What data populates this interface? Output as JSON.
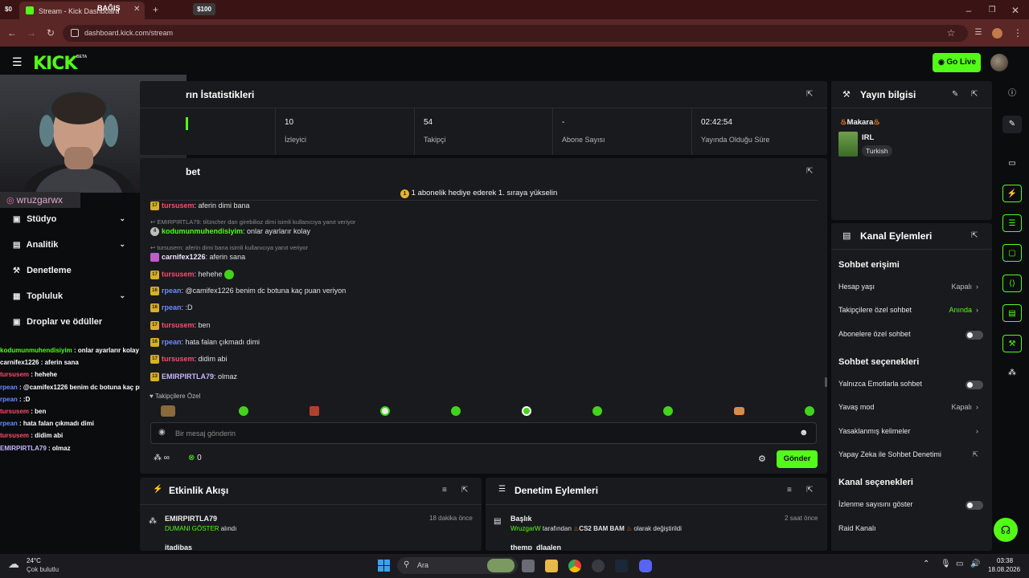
{
  "browser": {
    "tab0_label": "$0",
    "tab_title": "Stream - Kick Dashboard",
    "tab_overlay": "BAĞIŞ",
    "tab_overlay_amount": "$100",
    "url": "dashboard.kick.com/stream"
  },
  "topnav": {
    "logo": "KICK",
    "beta": "BETA",
    "go_live": "Go Live"
  },
  "overlay": {
    "instagram": "wruzgarwx"
  },
  "sidebar": {
    "items": [
      {
        "label": "Stüdyo",
        "icon": "studio-icon"
      },
      {
        "label": "Analitik",
        "icon": "chart-icon"
      },
      {
        "label": "Denetleme",
        "icon": "wrench-icon"
      },
      {
        "label": "Topluluk",
        "icon": "community-icon"
      },
      {
        "label": "Droplar ve ödüller",
        "icon": "gift-icon"
      }
    ]
  },
  "overlay_chat": [
    {
      "user": "kodumunmuhendisiyim",
      "text": " : onlar ayarlarır kolay",
      "color": "#53fc18"
    },
    {
      "user": "carnifex1226",
      "text": " : aferin sana",
      "color": "#ffffff"
    },
    {
      "user": "tursusem",
      "text": " : hehehe",
      "color": "#ff4b6e"
    },
    {
      "user": "rpean",
      "text": " : @camifex1226 benim dc botuna kaç puan veriyon",
      "color": "#6a8bff"
    },
    {
      "user": "rpean",
      "text": " : :D",
      "color": "#6a8bff"
    },
    {
      "user": "tursusem",
      "text": " : ben",
      "color": "#ff4b6e"
    },
    {
      "user": "rpean",
      "text": " : hata falan çıkmadı dimi",
      "color": "#6a8bff"
    },
    {
      "user": "tursusem",
      "text": " : didim abi",
      "color": "#ff4b6e"
    },
    {
      "user": "EMIRPIRTLA79",
      "text": " : olmaz",
      "color": "#c7b6ff"
    }
  ],
  "stats": {
    "title": "Yayın İstatistikleri",
    "title_visible": "rın İstatistikleri",
    "cells": [
      {
        "value": "10",
        "label": "İzleyici"
      },
      {
        "value": "54",
        "label": "Takipçi"
      },
      {
        "value": "-",
        "label": "Abone Sayısı"
      },
      {
        "value": "02:42:54",
        "label": "Yayında Olduğu Süre"
      }
    ]
  },
  "chat": {
    "title_visible": "bet",
    "pinned": "1 abonelik hediye ederek 1. sıraya yükselin",
    "messages": [
      {
        "badge": "17",
        "user": "tursusem",
        "color": "#ff4b6e",
        "text": ": aferin dimi bana"
      },
      {
        "reply": "EMIRPIRTLA79: tilüncher dan girebilioz dimi isimli kullanıcıya yanıt veriyor"
      },
      {
        "badge": "4",
        "user": "kodumunmuhendisiyim",
        "color": "#53fc18",
        "text": ": onlar ayarlarır kolay"
      },
      {
        "reply": "tursusem: aferin dimi bana isimli kullanıcıya yanıt veriyor"
      },
      {
        "badge": "",
        "user": "carnifex1226",
        "color": "#f2e6ff",
        "text": ": aferin sana"
      },
      {
        "badge": "17",
        "user": "tursusem",
        "color": "#ff4b6e",
        "text": ": hehehe"
      },
      {
        "badge": "16",
        "user": "rpean",
        "color": "#6a8bff",
        "text": ": @camifex1226 benim dc botuna kaç puan veriyon"
      },
      {
        "badge": "16",
        "user": "rpean",
        "color": "#6a8bff",
        "text": ": :D"
      },
      {
        "badge": "17",
        "user": "tursusem",
        "color": "#ff4b6e",
        "text": ": ben"
      },
      {
        "badge": "16",
        "user": "rpean",
        "color": "#6a8bff",
        "text": ": hata falan çıkmadı dimi"
      },
      {
        "badge": "17",
        "user": "tursusem",
        "color": "#ff4b6e",
        "text": ": didim abi"
      },
      {
        "badge": "13",
        "user": "EMIRPIRTLA79",
        "color": "#c7b6ff",
        "text": ": olmaz"
      }
    ],
    "followers_only": "Takipçilere Özel",
    "input_placeholder": "Bir mesaj gönderin",
    "points_value": "∞",
    "count": "0",
    "send": "Gönder"
  },
  "stream_info": {
    "title": "Yayın bilgisi",
    "stream_title": "Makara",
    "category": "IRL",
    "language": "Turkish"
  },
  "channel_actions": {
    "title": "Kanal Eylemleri",
    "sections": [
      {
        "heading": "Sohbet erişimi"
      },
      {
        "label": "Hesap yaşı",
        "value": "Kapalı",
        "kind": "chevron"
      },
      {
        "label": "Takipçilere özel sohbet",
        "value": "Anında",
        "kind": "chevron",
        "accent": true
      },
      {
        "label": "Abonelere özel sohbet",
        "kind": "toggle"
      },
      {
        "heading": "Sohbet seçenekleri"
      },
      {
        "label": "Yalnızca Emotlarla sohbet",
        "kind": "toggle"
      },
      {
        "label": "Yavaş mod",
        "value": "Kapalı",
        "kind": "chevron"
      },
      {
        "label": "Yasaklanmış kelimeler",
        "kind": "chevron"
      },
      {
        "label": "Yapay Zeka ile Sohbet Denetimi",
        "kind": "external"
      },
      {
        "heading": "Kanal seçenekleri"
      },
      {
        "label": "İzlenme sayısını göster",
        "kind": "toggle"
      },
      {
        "label": "Raid Kanalı",
        "kind": "none"
      }
    ]
  },
  "activity_feed": {
    "title": "Etkinlik Akışı",
    "entries": [
      {
        "user": "EMIRPIRTLA79",
        "time": "18 dakika önce",
        "highlight": "DUMANI GÖSTER",
        "rest": " alındı"
      }
    ],
    "partial_user": "itadibas"
  },
  "mod_actions": {
    "title": "Denetim Eylemleri",
    "entries": [
      {
        "title": "Başlık",
        "time": "2 saat önce",
        "user": "WruzgarW",
        "mid": " tarafından ",
        "value": "CS2 BAM BAM",
        "rest": " olarak değiştirildi"
      }
    ],
    "partial_user": "themp_dlaalen"
  },
  "taskbar": {
    "temp": "24°C",
    "weather": "Çok bulutlu",
    "search": "Ara",
    "time": "03:38",
    "date": "18.08.2026"
  },
  "colors": {
    "accent": "#53fc18",
    "panel": "#191a1e",
    "bg": "#0b0c0e"
  }
}
